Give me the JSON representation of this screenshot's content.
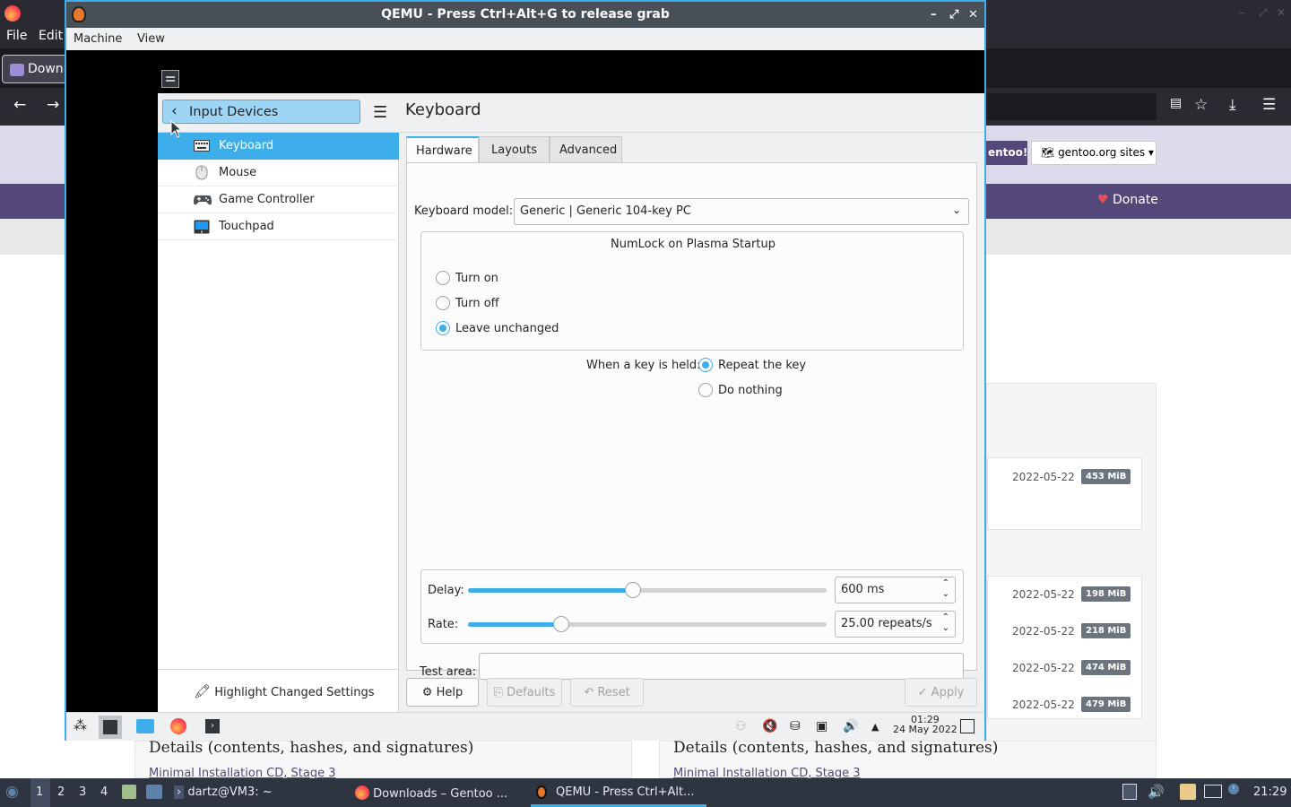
{
  "background_browser": {
    "menu": {
      "file": "File",
      "edit": "Edit"
    },
    "tab_title": "Downl",
    "site_badge": "entoo!",
    "sites_button": "gentoo.org sites",
    "donate": "Donate",
    "downloads": [
      {
        "date": "2022-05-22",
        "size": "453 MiB"
      },
      {
        "date": "2022-05-22",
        "size": "198 MiB"
      },
      {
        "date": "2022-05-22",
        "size": "218 MiB"
      },
      {
        "date": "2022-05-22",
        "size": "474 MiB"
      },
      {
        "date": "2022-05-22",
        "size": "479 MiB"
      }
    ],
    "details_left": "Details (contents, hashes, and signatures)",
    "details_right": "Details (contents, hashes, and signatures)",
    "link_left": "Minimal Installation CD, Stage 3",
    "link_right": "Minimal Installation CD, Stage 3"
  },
  "qemu": {
    "title": "QEMU - Press Ctrl+Alt+G to release grab",
    "menu": {
      "machine": "Machine",
      "view": "View"
    }
  },
  "system_settings": {
    "breadcrumb": "Input Devices",
    "sidebar": [
      {
        "label": "Keyboard",
        "icon": "keyboard-icon",
        "selected": true
      },
      {
        "label": "Mouse",
        "icon": "mouse-icon",
        "selected": false
      },
      {
        "label": "Game Controller",
        "icon": "gamepad-icon",
        "selected": false
      },
      {
        "label": "Touchpad",
        "icon": "touchpad-icon",
        "selected": false
      }
    ],
    "highlight_changed": "Highlight Changed Settings",
    "page_title": "Keyboard",
    "tabs": [
      "Hardware",
      "Layouts",
      "Advanced"
    ],
    "active_tab": "Hardware",
    "keyboard_model_label": "Keyboard model:",
    "keyboard_model_value": "Generic | Generic 104-key PC",
    "numlock": {
      "title": "NumLock on Plasma Startup",
      "options": [
        "Turn on",
        "Turn off",
        "Leave unchanged"
      ],
      "selected": "Leave unchanged"
    },
    "key_held": {
      "label": "When a key is held:",
      "options": [
        "Repeat the key",
        "Do nothing"
      ],
      "selected": "Repeat the key"
    },
    "delay": {
      "label": "Delay:",
      "value": "600 ms",
      "slider_fraction": 0.46
    },
    "rate": {
      "label": "Rate:",
      "value": "25.00 repeats/s",
      "slider_fraction": 0.26
    },
    "test_area_label": "Test area:",
    "buttons": {
      "help": "Help",
      "defaults": "Defaults",
      "reset": "Reset",
      "apply": "Apply"
    }
  },
  "guest_panel": {
    "clock_time": "01:29",
    "clock_date": "24 May 2022"
  },
  "host_taskbar": {
    "workspaces": [
      "1",
      "2",
      "3",
      "4"
    ],
    "tasks": [
      "dartz@VM3: ~",
      "Downloads – Gentoo ...",
      "QEMU - Press Ctrl+Alt..."
    ],
    "clock": "21:29"
  },
  "colors": {
    "accent": "#3daee9",
    "gentoo_purple": "#54487a"
  }
}
